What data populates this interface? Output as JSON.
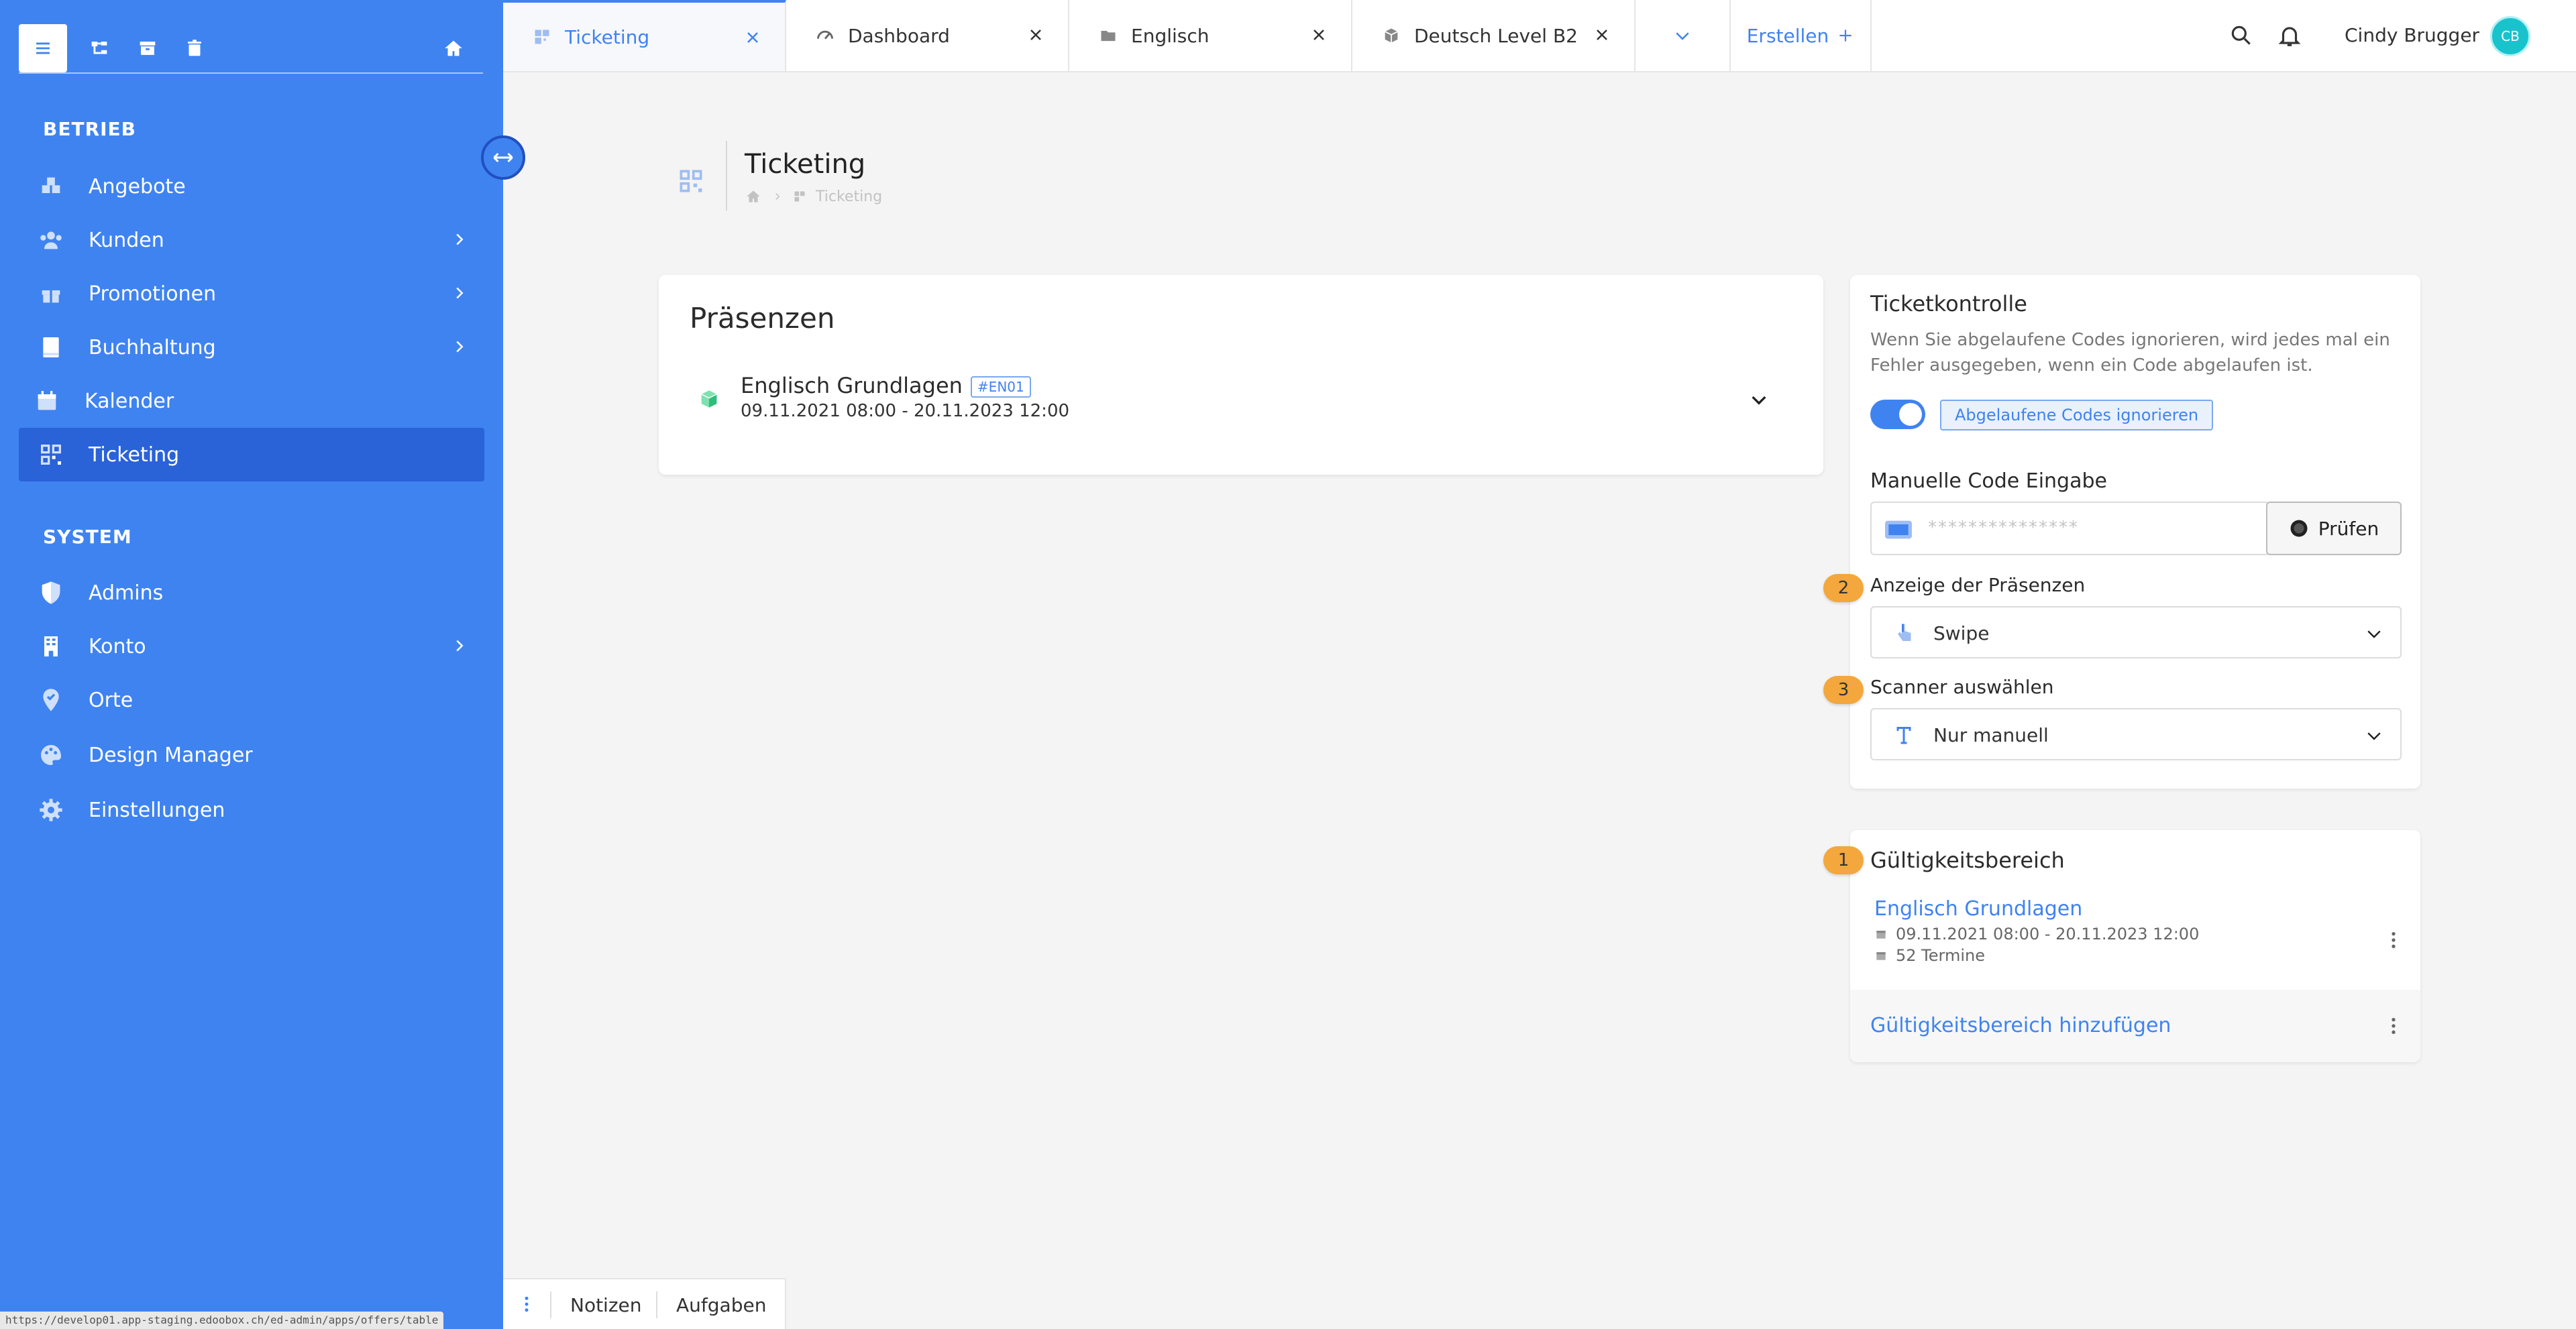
{
  "sidebar": {
    "toolbar": [
      "menu-icon",
      "hierarchy-icon",
      "archive-icon",
      "trash-icon",
      "home-icon"
    ],
    "sections": [
      {
        "title": "BETRIEB"
      },
      {
        "title": "SYSTEM"
      }
    ],
    "items": [
      {
        "label": "Angebote"
      },
      {
        "label": "Kunden"
      },
      {
        "label": "Promotionen"
      },
      {
        "label": "Buchhaltung"
      },
      {
        "label": "Kalender"
      },
      {
        "label": "Ticketing"
      },
      {
        "label": "Admins"
      },
      {
        "label": "Konto"
      },
      {
        "label": "Orte"
      },
      {
        "label": "Design Manager"
      },
      {
        "label": "Einstellungen"
      }
    ],
    "status_url": "https://develop01.app-staging.edoobox.ch/ed-admin/apps/offers/table"
  },
  "tabs": [
    {
      "label": "Ticketing"
    },
    {
      "label": "Dashboard"
    },
    {
      "label": "Englisch"
    },
    {
      "label": "Deutsch Level B2"
    }
  ],
  "create_label": "Erstellen",
  "user": {
    "name": "Cindy Brugger",
    "initials": "CB"
  },
  "page": {
    "title": "Ticketing",
    "breadcrumb": "Ticketing"
  },
  "praesenzen": {
    "title": "Präsenzen",
    "item_title": "Englisch Grundlagen",
    "item_tag": "#EN01",
    "item_dates": "09.11.2021 08:00 - 20.11.2023 12:00"
  },
  "ticketkontrolle": {
    "title": "Ticketkontrolle",
    "description": "Wenn Sie abgelaufene Codes ignorieren, wird jedes mal ein Fehler ausgegeben, wenn ein Code abgelaufen ist.",
    "toggle_label": "Abgelaufene Codes ignorieren",
    "manual_label": "Manuelle Code Eingabe",
    "manual_placeholder": "***************",
    "check_button": "Prüfen",
    "display_badge": "2",
    "display_label": "Anzeige der Präsenzen",
    "display_value": "Swipe",
    "scanner_badge": "3",
    "scanner_label": "Scanner auswählen",
    "scanner_value": "Nur manuell"
  },
  "gueltigkeit": {
    "badge": "1",
    "title": "Gültigkeitsbereich",
    "item_title": "Englisch Grundlagen",
    "item_dates": "09.11.2021 08:00 - 20.11.2023 12:00",
    "item_count": "52 Termine",
    "add_label": "Gültigkeitsbereich hinzufügen"
  },
  "bottom": {
    "notes": "Notizen",
    "tasks": "Aufgaben"
  },
  "colors": {
    "accent": "#3f83f0",
    "badge": "#f3a73c",
    "avatar": "#18c3cc"
  }
}
